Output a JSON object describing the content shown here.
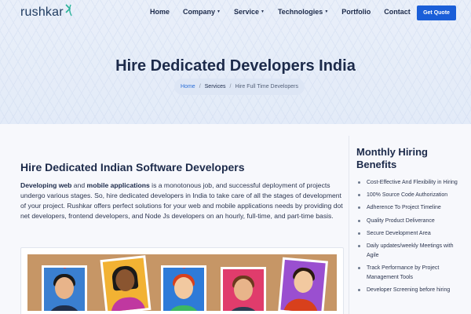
{
  "header": {
    "logo_text": "rushkar",
    "nav": [
      {
        "label": "Home",
        "has_caret": false
      },
      {
        "label": "Company",
        "has_caret": true
      },
      {
        "label": "Service",
        "has_caret": true
      },
      {
        "label": "Technologies",
        "has_caret": true
      },
      {
        "label": "Portfolio",
        "has_caret": false
      },
      {
        "label": "Contact",
        "has_caret": false
      }
    ],
    "cta_label": "Get Quote",
    "caret_glyph": "▼"
  },
  "hero": {
    "title": "Hire Dedicated Developers India",
    "breadcrumb": {
      "home": "Home",
      "separator": "/",
      "middle": "Services",
      "current": "Hire Full Time Developers"
    }
  },
  "content": {
    "title": "Hire Dedicated Indian Software Developers",
    "para_bold_1": "Developing web",
    "para_text_1": " and ",
    "para_bold_2": "mobile applications",
    "para_text_2": " is a monotonous job, and successful deployment of projects undergo various stages. So, hire dedicated developers in India to take care of all the stages of development of your project. Rushkar offers perfect solutions for your web and mobile applications needs by providing dot net developers, frontend developers, and Node Js developers on an hourly, full-time, and part-time basis."
  },
  "sidebar": {
    "title": "Monthly Hiring Benefits",
    "items": [
      "Cost-Effective And Flexibility in Hiring",
      "100% Source Code Authorization",
      "Adherence To Project Timeline",
      "Quality Product Deliverance",
      "Secure Development Area",
      "Daily updates/weekly Meetings with Agile",
      "Track Performance by Project Management Tools",
      "Developer Screening before hiring"
    ]
  },
  "colors": {
    "accent": "#1a5ed8",
    "text_dark": "#1c2a4a",
    "board": "#c69666"
  }
}
